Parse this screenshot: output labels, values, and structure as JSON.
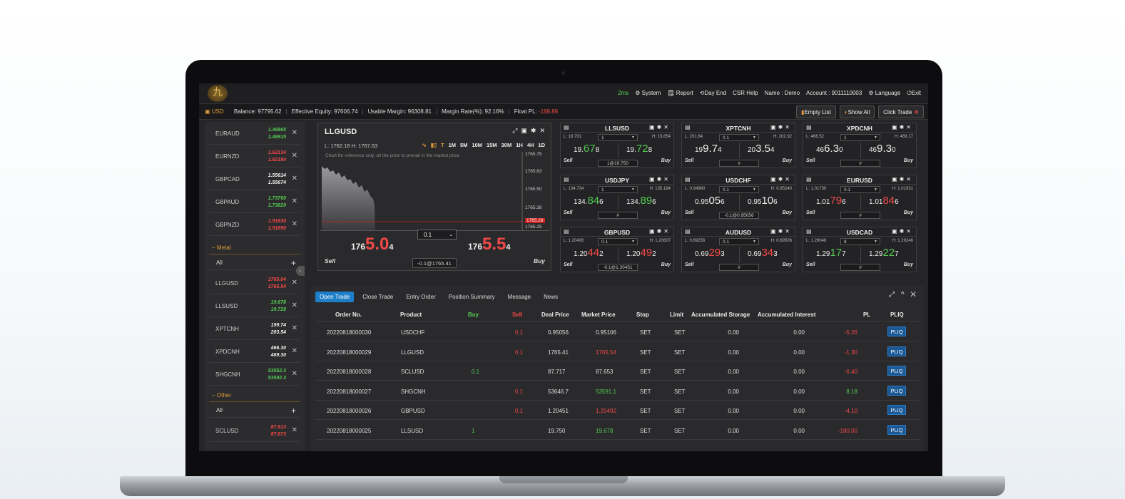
{
  "topbar": {
    "logo_text": "九",
    "latency": "2ms",
    "system": "⚙ System",
    "report": "🗒 Report",
    "day_end": "⟲Day End",
    "csr_help": "CSR Help",
    "name": "Name : Demo",
    "account": "Account : 9011110003",
    "language": "⚙ Language",
    "exit": "⏻Exit"
  },
  "info": {
    "currency": "USD",
    "balance": "Balance:  97795.62",
    "equity": "Effective Equity:  97606.74",
    "usable_margin": "Usable Margin:  96308.81",
    "margin_rate": "Margin Rate(%):  92.16%",
    "float_pl_label": "Float PL:",
    "float_pl_value": "-188.88",
    "empty_list": "Empty List",
    "show_all": "Show All",
    "click_trade": "Click Trade"
  },
  "sidebar": {
    "fx": [
      {
        "name": "EURAUD",
        "bid": "1.46865",
        "ask": "1.46915",
        "color": "#54c954"
      },
      {
        "name": "EURNZD",
        "bid": "1.62134",
        "ask": "1.62184",
        "color": "#f24848"
      },
      {
        "name": "GBPCAD",
        "bid": "1.55614",
        "ask": "1.55674",
        "color": "#eeeeee"
      },
      {
        "name": "GBPAUD",
        "bid": "1.73760",
        "ask": "1.73820",
        "color": "#54c954"
      },
      {
        "name": "GBPNZD",
        "bid": "1.91830",
        "ask": "1.91890",
        "color": "#f24848"
      }
    ],
    "metal_group": "Metal",
    "metal_all": "All",
    "metal": [
      {
        "name": "LLGUSD",
        "bid": "1765.04",
        "ask": "1765.54",
        "color": "#f24848"
      },
      {
        "name": "LLSUSD",
        "bid": "19.678",
        "ask": "19.728",
        "color": "#54c954"
      },
      {
        "name": "XPTCNH",
        "bid": "199.74",
        "ask": "203.54",
        "color": "#eeeeee"
      },
      {
        "name": "XPDCNH",
        "bid": "466.30",
        "ask": "469.30",
        "color": "#eeeeee"
      },
      {
        "name": "SHGCNH",
        "bid": "53552.3",
        "ask": "53592.3",
        "color": "#54c954"
      }
    ],
    "other_group": "Other",
    "other_all": "All",
    "other": [
      {
        "name": "SCLUSD",
        "bid": "87.613",
        "ask": "87.673",
        "color": "#f24848"
      }
    ]
  },
  "chart_panel": {
    "title": "LLGUSD",
    "low_high": "L: 1762.18   H: 1767.63",
    "timeframes": [
      "T",
      "1M",
      "5M",
      "10M",
      "15M",
      "30M",
      "1H",
      "4H",
      "1D"
    ],
    "note": "Chart for reference only, all the price to prevail in the market price",
    "y_ticks": [
      "1765.75",
      "1765.63",
      "1765.50",
      "1765.38",
      "1765.29",
      "1765.25"
    ],
    "sell_small": "176",
    "sell_big": "5.0",
    "sell_sup": "4",
    "buy_small": "176",
    "buy_big": "5.5",
    "buy_sup": "4",
    "lot": "0.1",
    "order_info": "-0.1@1765.41",
    "sell_label": "Sell",
    "buy_label": "Buy"
  },
  "cards": [
    {
      "name": "LLSUSD",
      "low": "L: 19.701",
      "high": "H: 19.854",
      "lot": "1",
      "s1": "19.",
      "s2": "67",
      "s3": "8",
      "b1": "19.",
      "b2": "72",
      "b3": "8",
      "color": "#54c954",
      "pos": "1@19.750"
    },
    {
      "name": "XPTCNH",
      "low": "L: 201.64",
      "high": "H: 202.92",
      "lot": "0.1",
      "s1": "19",
      "s2": "9.7",
      "s3": "4",
      "b1": "20",
      "b2": "3.5",
      "b3": "4",
      "color": "#eeeeee",
      "pos": "#"
    },
    {
      "name": "XPDCNH",
      "low": "L: 466.52",
      "high": "H: 469.17",
      "lot": "1",
      "s1": "46",
      "s2": "6.3",
      "s3": "0",
      "b1": "46",
      "b2": "9.3",
      "b3": "0",
      "color": "#eeeeee",
      "pos": "#"
    },
    {
      "name": "USDJPY",
      "low": "L: 134.734",
      "high": "H: 135.184",
      "lot": "1",
      "s1": "134.",
      "s2": "84",
      "s3": "6",
      "b1": "134.",
      "b2": "89",
      "b3": "6",
      "color": "#54c954",
      "pos": "#"
    },
    {
      "name": "USDCHF",
      "low": "L: 0.94980",
      "high": "H: 0.95240",
      "lot": "0.1",
      "s1": "0.95",
      "s2": "05",
      "s3": "6",
      "b1": "0.95",
      "b2": "10",
      "b3": "6",
      "color": "#eeeeee",
      "pos": "-0.1@0.95056"
    },
    {
      "name": "EURUSD",
      "low": "L: 1.01730",
      "high": "H: 1.01931",
      "lot": "0.1",
      "s1": "1.01",
      "s2": "79",
      "s3": "6",
      "b1": "1.01",
      "b2": "84",
      "b3": "6",
      "color": "#f24848",
      "pos": "#"
    },
    {
      "name": "GBPUSD",
      "low": "L: 1.20406",
      "high": "H: 1.20607",
      "lot": "0.1",
      "s1": "1.20",
      "s2": "44",
      "s3": "2",
      "b1": "1.20",
      "b2": "49",
      "b3": "2",
      "color": "#f24848",
      "pos": "-0.1@1.20451"
    },
    {
      "name": "AUDUSD",
      "low": "L: 0.69256",
      "high": "H: 0.69506",
      "lot": "0.1",
      "s1": "0.69",
      "s2": "29",
      "s3": "3",
      "b1": "0.69",
      "b2": "34",
      "b3": "3",
      "color": "#f24848",
      "pos": "#"
    },
    {
      "name": "USDCAD",
      "low": "L: 1.29048",
      "high": "H: 1.29246",
      "lot": "8",
      "s1": "1.29",
      "s2": "17",
      "s3": "7",
      "b1": "1.29",
      "b2": "22",
      "b3": "7",
      "color": "#54c954",
      "pos": "#"
    }
  ],
  "card_sell": "Sell",
  "card_buy": "Buy",
  "orders": {
    "tabs": [
      "Open Trade",
      "Close Trade",
      "Entry Order",
      "Position Summary",
      "Message",
      "News"
    ],
    "window_controls": "⤢ ^ ✕",
    "headers": [
      "Order No.",
      "Product",
      "Buy",
      "Sell",
      "Deal Price",
      "Market Price",
      "Stop",
      "Limit",
      "Accumulated Storage",
      "Accumulated Interest",
      "PL",
      "PLIQ"
    ],
    "rows": [
      {
        "order": "20220818000030",
        "product": "USDCHF",
        "buy": "",
        "sell": "0.1",
        "deal": "0.95056",
        "market": "0.95106",
        "market_color": "#dddddd",
        "stop": "SET",
        "limit": "SET",
        "storage": "0.00",
        "interest": "0.00",
        "pl": "-5.26",
        "pl_color": "#f24848",
        "pliq": "PLIQ"
      },
      {
        "order": "20220818000029",
        "product": "LLGUSD",
        "buy": "",
        "sell": "0.1",
        "deal": "1765.41",
        "market": "1765.54",
        "market_color": "#f24848",
        "stop": "SET",
        "limit": "SET",
        "storage": "0.00",
        "interest": "0.00",
        "pl": "-1.30",
        "pl_color": "#f24848",
        "pliq": "PLIQ"
      },
      {
        "order": "20220818000028",
        "product": "SCLUSD",
        "buy": "0.1",
        "sell": "",
        "deal": "87.717",
        "market": "87.653",
        "market_color": "#dddddd",
        "stop": "SET",
        "limit": "SET",
        "storage": "0.00",
        "interest": "0.00",
        "pl": "-6.40",
        "pl_color": "#f24848",
        "pliq": "PLIQ"
      },
      {
        "order": "20220818000027",
        "product": "SHGCNH",
        "buy": "",
        "sell": "0.1",
        "deal": "53646.7",
        "market": "53591.1",
        "market_color": "#54c954",
        "stop": "SET",
        "limit": "SET",
        "storage": "0.00",
        "interest": "0.00",
        "pl": "8.18",
        "pl_color": "#54c954",
        "pliq": "PLIQ"
      },
      {
        "order": "20220818000026",
        "product": "GBPUSD",
        "buy": "",
        "sell": "0.1",
        "deal": "1.20451",
        "market": "1.20492",
        "market_color": "#f24848",
        "stop": "SET",
        "limit": "SET",
        "storage": "0.00",
        "interest": "0.00",
        "pl": "-4.10",
        "pl_color": "#f24848",
        "pliq": "PLIQ"
      },
      {
        "order": "20220818000025",
        "product": "LLSUSD",
        "buy": "1",
        "sell": "",
        "deal": "19.750",
        "market": "19.678",
        "market_color": "#54c954",
        "stop": "SET",
        "limit": "SET",
        "storage": "0.00",
        "interest": "0.00",
        "pl": "-180.00",
        "pl_color": "#f24848",
        "pliq": "PLIQ"
      }
    ]
  },
  "colors": {
    "accent": "#e39a3c",
    "up": "#54c954",
    "down": "#f24848",
    "button": "#1c5a97"
  }
}
